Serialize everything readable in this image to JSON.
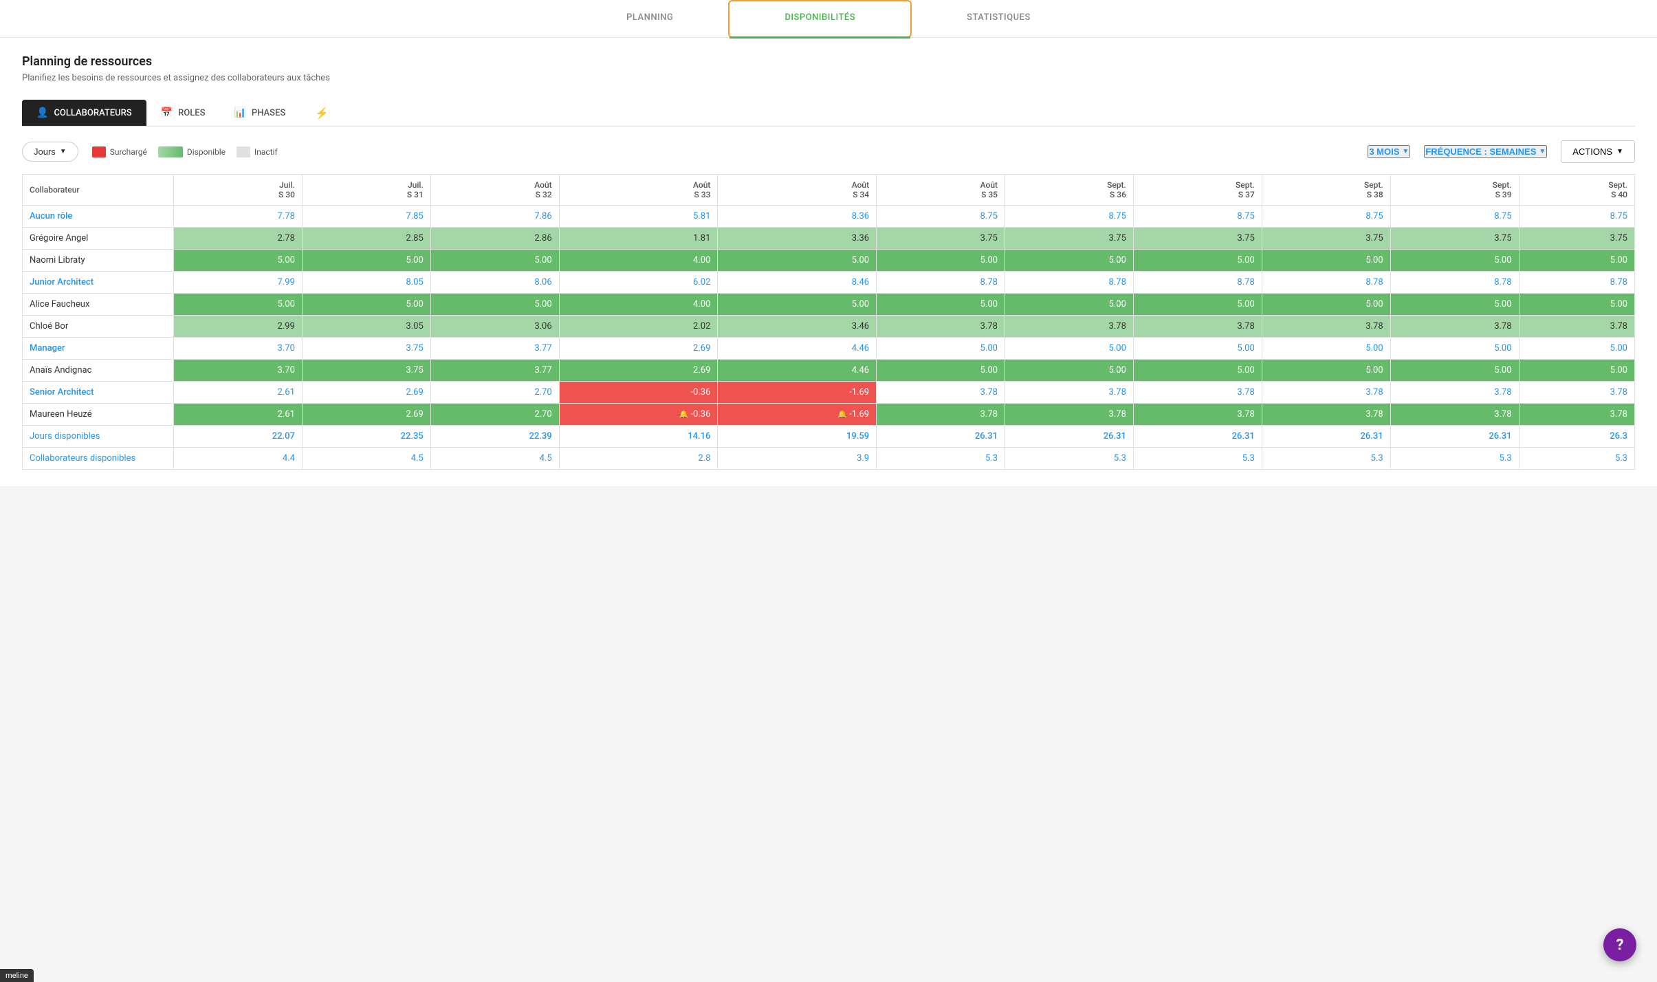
{
  "nav": {
    "tabs": [
      {
        "id": "planning",
        "label": "PLANNING",
        "active": false
      },
      {
        "id": "disponibilites",
        "label": "DISPONIBILITÉS",
        "active": true
      },
      {
        "id": "statistiques",
        "label": "STATISTIQUES",
        "active": false
      }
    ]
  },
  "page": {
    "title": "Planning de ressources",
    "subtitle": "Planifiez les besoins de ressources et assignez des collaborateurs aux tâches"
  },
  "tabs": [
    {
      "id": "collaborateurs",
      "label": "COLLABORATEURS",
      "icon": "👤",
      "active": true
    },
    {
      "id": "roles",
      "label": "ROLES",
      "icon": "📅",
      "active": false
    },
    {
      "id": "phases",
      "label": "PHASES",
      "icon": "📊",
      "active": false
    }
  ],
  "filter_icon": "≡",
  "toolbar": {
    "jours_label": "Jours",
    "legend": [
      {
        "id": "surcharge",
        "label": "Surchargé",
        "color": "#e53935"
      },
      {
        "id": "disponible",
        "label": "Disponible",
        "color": "#66bb6a"
      },
      {
        "id": "inactif",
        "label": "Inactif",
        "color": "#e0e0e0"
      }
    ],
    "period_label": "3 MOIS",
    "freq_label": "FRÉQUENCE : SEMAINES",
    "actions_label": "ACTIONS"
  },
  "table": {
    "col_name_header": "Collaborateur",
    "columns": [
      {
        "month": "Juil.",
        "week": "S 30"
      },
      {
        "month": "Juil.",
        "week": "S 31"
      },
      {
        "month": "Août",
        "week": "S 32"
      },
      {
        "month": "Août",
        "week": "S 33"
      },
      {
        "month": "Août",
        "week": "S 34"
      },
      {
        "month": "Août",
        "week": "S 35"
      },
      {
        "month": "Sept.",
        "week": "S 36"
      },
      {
        "month": "Sept.",
        "week": "S 37"
      },
      {
        "month": "Sept.",
        "week": "S 38"
      },
      {
        "month": "Sept.",
        "week": "S 39"
      },
      {
        "month": "Sept.",
        "week": "S 40"
      }
    ],
    "rows": [
      {
        "type": "role",
        "name": "Aucun rôle",
        "values": [
          "7.78",
          "7.85",
          "7.86",
          "5.81",
          "8.36",
          "8.75",
          "8.75",
          "8.75",
          "8.75",
          "8.75",
          "8.75"
        ]
      },
      {
        "type": "person-light",
        "name": "Grégoire Angel",
        "values": [
          "2.78",
          "2.85",
          "2.86",
          "1.81",
          "3.36",
          "3.75",
          "3.75",
          "3.75",
          "3.75",
          "3.75",
          "3.75"
        ]
      },
      {
        "type": "person",
        "name": "Naomi Libraty",
        "values": [
          "5.00",
          "5.00",
          "5.00",
          "4.00",
          "5.00",
          "5.00",
          "5.00",
          "5.00",
          "5.00",
          "5.00",
          "5.00"
        ]
      },
      {
        "type": "role",
        "name": "Junior Architect",
        "values": [
          "7.99",
          "8.05",
          "8.06",
          "6.02",
          "8.46",
          "8.78",
          "8.78",
          "8.78",
          "8.78",
          "8.78",
          "8.78"
        ]
      },
      {
        "type": "person",
        "name": "Alice Faucheux",
        "values": [
          "5.00",
          "5.00",
          "5.00",
          "4.00",
          "5.00",
          "5.00",
          "5.00",
          "5.00",
          "5.00",
          "5.00",
          "5.00"
        ]
      },
      {
        "type": "person-light",
        "name": "Chloé Bor",
        "values": [
          "2.99",
          "3.05",
          "3.06",
          "2.02",
          "3.46",
          "3.78",
          "3.78",
          "3.78",
          "3.78",
          "3.78",
          "3.78"
        ]
      },
      {
        "type": "role",
        "name": "Manager",
        "values": [
          "3.70",
          "3.75",
          "3.77",
          "2.69",
          "4.46",
          "5.00",
          "5.00",
          "5.00",
          "5.00",
          "5.00",
          "5.00"
        ]
      },
      {
        "type": "person",
        "name": "Anaïs Andignac",
        "values": [
          "3.70",
          "3.75",
          "3.77",
          "2.69",
          "4.46",
          "5.00",
          "5.00",
          "5.00",
          "5.00",
          "5.00",
          "5.00"
        ]
      },
      {
        "type": "role",
        "name": "Senior Architect",
        "values": [
          "2.61",
          "2.69",
          "2.70",
          "-0.36",
          "-1.69",
          "3.78",
          "3.78",
          "3.78",
          "3.78",
          "3.78",
          "3.78"
        ],
        "red_cols": [
          3,
          4
        ]
      },
      {
        "type": "person-bell",
        "name": "Maureen Heuzé",
        "values": [
          "2.61",
          "2.69",
          "2.70",
          "-0.36",
          "-1.69",
          "3.78",
          "3.78",
          "3.78",
          "3.78",
          "3.78",
          "3.78"
        ],
        "red_cols": [
          3,
          4
        ]
      },
      {
        "type": "jours",
        "name": "Jours disponibles",
        "values": [
          "22.07",
          "22.35",
          "22.39",
          "14.16",
          "19.59",
          "26.31",
          "26.31",
          "26.31",
          "26.31",
          "26.31",
          "26.3"
        ]
      },
      {
        "type": "collab",
        "name": "ollaborateurs disponibles",
        "name_prefix": "c",
        "values": [
          "4.4",
          "4.5",
          "4.5",
          "2.8",
          "3.9",
          "5.3",
          "5.3",
          "5.3",
          "5.3",
          "5.3",
          "5.3"
        ]
      }
    ]
  },
  "help_btn_label": "?",
  "timeline_label": "meline"
}
